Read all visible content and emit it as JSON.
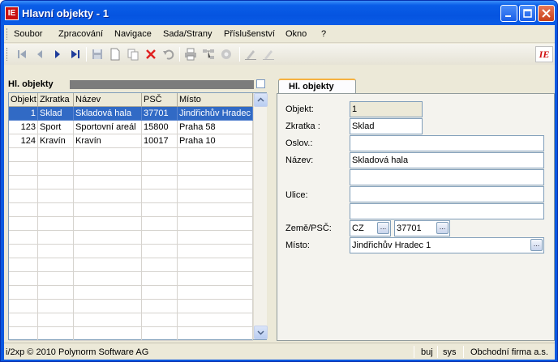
{
  "window": {
    "title": "Hlavní objekty - 1",
    "logo": "IE"
  },
  "menu": [
    "Soubor",
    "Zpracování",
    "Navigace",
    "Sada/Strany",
    "Příslušenství",
    "Okno",
    "?"
  ],
  "toolbar": {
    "icons": [
      "first-record-icon",
      "prev-record-icon",
      "next-record-icon",
      "last-record-icon",
      "save-icon",
      "new-icon",
      "copy-icon",
      "delete-icon",
      "undo-icon",
      "print-icon",
      "tree-icon",
      "settings-icon",
      "edit-icon",
      "edit-disabled-icon"
    ],
    "brand": "IE"
  },
  "left_panel": {
    "title": "Hl. objekty",
    "columns": [
      "Objekt",
      "Zkratka",
      "Název",
      "PSČ",
      "Místo"
    ],
    "rows": [
      {
        "objekt": "1",
        "zkratka": "Sklad",
        "nazev": "Skladová hala",
        "psc": "37701",
        "misto": "Jindřichův Hradec"
      },
      {
        "objekt": "123",
        "zkratka": "Sport",
        "nazev": "Sportovní areál",
        "psc": "15800",
        "misto": "Praha 58"
      },
      {
        "objekt": "124",
        "zkratka": "Kravín",
        "nazev": "Kravín",
        "psc": "10017",
        "misto": "Praha 10"
      }
    ]
  },
  "right_panel": {
    "tab": "Hl. objekty",
    "labels": {
      "objekt": "Objekt:",
      "zkratka": "Zkratka :",
      "oslov": "Oslov.:",
      "nazev": "Název:",
      "ulice": "Ulice:",
      "zeme_psc": "Země/PSČ:",
      "misto": "Místo:"
    },
    "values": {
      "objekt": "1",
      "zkratka": "Sklad",
      "oslov": "",
      "nazev": "Skladová hala",
      "nazev2": "",
      "ulice1": "",
      "ulice2": "",
      "zeme": "CZ",
      "psc": "37701",
      "misto": "Jindřichův Hradec 1"
    },
    "lookup_label": "..."
  },
  "status": {
    "copyright": "i/2xp © 2010 Polynorm Software AG",
    "user": "buj",
    "db": "sys",
    "company": "Obchodní firma a.s."
  },
  "colors": {
    "title_blue": "#0a5ee8",
    "selection": "#316ac5",
    "tab_accent": "#f6b240"
  }
}
